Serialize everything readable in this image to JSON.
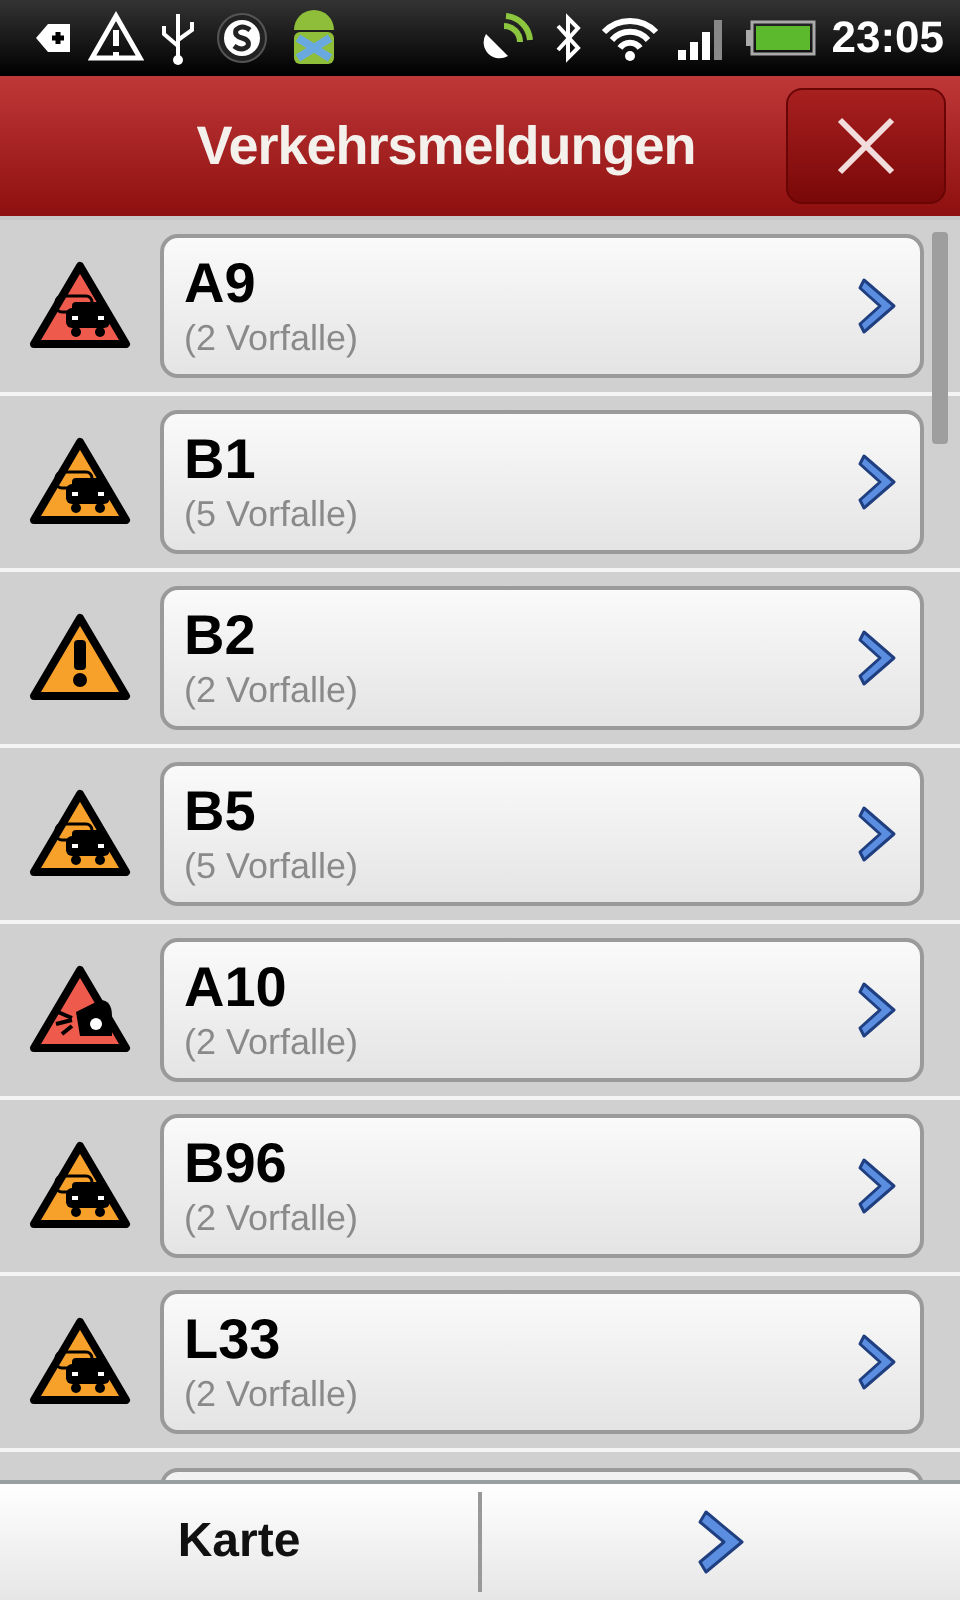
{
  "status_bar": {
    "time": "23:05"
  },
  "header": {
    "title": "Verkehrsmeldungen"
  },
  "incidents": [
    {
      "road": "A9",
      "count": "(2 Vorfalle)",
      "kind": "jam",
      "color": "#ee5a4c"
    },
    {
      "road": "B1",
      "count": "(5 Vorfalle)",
      "kind": "jam",
      "color": "#f7a12b"
    },
    {
      "road": "B2",
      "count": "(2 Vorfalle)",
      "kind": "warning",
      "color": "#f7a12b"
    },
    {
      "road": "B5",
      "count": "(5 Vorfalle)",
      "kind": "jam",
      "color": "#f7a12b"
    },
    {
      "road": "A10",
      "count": "(2 Vorfalle)",
      "kind": "accident",
      "color": "#ee5a4c"
    },
    {
      "road": "B96",
      "count": "(2 Vorfalle)",
      "kind": "jam",
      "color": "#f7a12b"
    },
    {
      "road": "L33",
      "count": "(2 Vorfalle)",
      "kind": "jam",
      "color": "#f7a12b"
    }
  ],
  "bottom_bar": {
    "map_button": "Karte"
  }
}
